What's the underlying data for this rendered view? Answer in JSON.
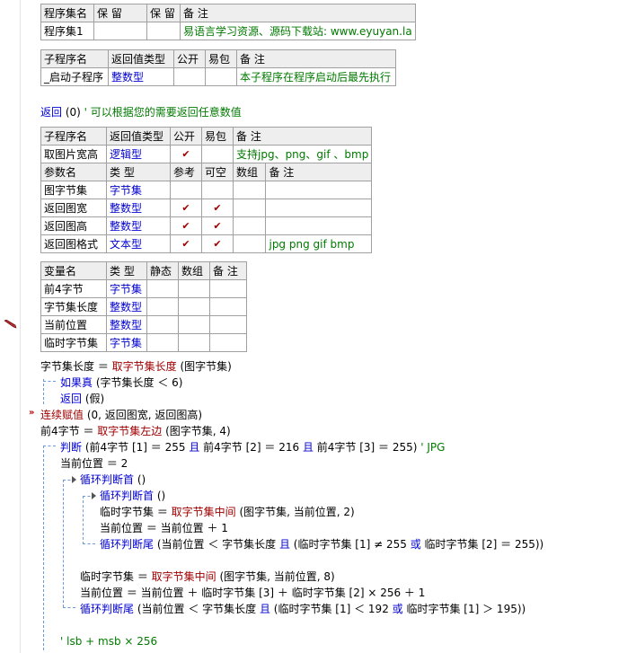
{
  "program_set": {
    "headers": [
      "程序集名",
      "保 留",
      "保 留",
      "备 注"
    ],
    "row": {
      "name": "程序集1",
      "r1": "",
      "r2": "",
      "note": "易语言学习资源、源码下载站: www.eyuyan.la"
    }
  },
  "sub_startup": {
    "headers": [
      "子程序名",
      "返回值类型",
      "公开",
      "易包",
      "备 注"
    ],
    "row": {
      "name": "_启动子程序",
      "type": "整数型",
      "public": "",
      "epkg": "",
      "note": "本子程序在程序启动后最先执行"
    }
  },
  "return_line": {
    "kw": "返回",
    "arg": " (0) ",
    "comment": "' 可以根据您的需要返回任意数值"
  },
  "sub_getsize": {
    "headers": [
      "子程序名",
      "返回值类型",
      "公开",
      "易包",
      "备 注"
    ],
    "row": {
      "name": "取图片宽高",
      "type": "逻辑型",
      "public": "✔",
      "epkg": "",
      "note": "支持jpg、png、gif 、bmp"
    },
    "param_headers": [
      "参数名",
      "类 型",
      "参考",
      "可空",
      "数组",
      "备 注"
    ],
    "params": [
      {
        "name": "图字节集",
        "type": "字节集",
        "ref": "",
        "opt": "",
        "arr": "",
        "note": ""
      },
      {
        "name": "返回图宽",
        "type": "整数型",
        "ref": "✔",
        "opt": "✔",
        "arr": "",
        "note": ""
      },
      {
        "name": "返回图高",
        "type": "整数型",
        "ref": "✔",
        "opt": "✔",
        "arr": "",
        "note": ""
      },
      {
        "name": "返回图格式",
        "type": "文本型",
        "ref": "✔",
        "opt": "✔",
        "arr": "",
        "note": "jpg png gif bmp"
      }
    ]
  },
  "locals": {
    "headers": [
      "变量名",
      "类 型",
      "静态",
      "数组",
      "备 注"
    ],
    "rows": [
      {
        "name": "前4字节",
        "type": "字节集"
      },
      {
        "name": "字节集长度",
        "type": "整数型"
      },
      {
        "name": "当前位置",
        "type": "整数型"
      },
      {
        "name": "临时字节集",
        "type": "字节集"
      }
    ]
  },
  "code": {
    "l1": {
      "a": "字节集长度 ＝ ",
      "f": "取字节集长度",
      "b": " (图字节集)"
    },
    "l2": {
      "k": "如果真",
      "b": " (字节集长度 ＜ 6)"
    },
    "l3": {
      "k": "返回",
      "b": " (假)"
    },
    "l4": {
      "f": "连续赋值",
      "b": " (0, 返回图宽, 返回图高)"
    },
    "l5": {
      "a": "前4字节 ＝ ",
      "f": "取字节集左边",
      "b": " (图字节集, 4)"
    },
    "l6": {
      "k": "判断",
      "b1": " (前4字节 [1] ＝ 255 ",
      "k2": "且",
      "b2": " 前4字节 [2] ＝ 216 ",
      "k3": "且",
      "b3": " 前4字节 [3] ＝ 255) ",
      "c": "' JPG"
    },
    "l7": {
      "a": "当前位置 ＝ 2"
    },
    "l8": {
      "k": "循环判断首",
      "b": " ()"
    },
    "l9": {
      "k": "循环判断首",
      "b": " ()"
    },
    "l10": {
      "a": "临时字节集 ＝ ",
      "f": "取字节集中间",
      "b": " (图字节集, 当前位置, 2)"
    },
    "l11": {
      "a": "当前位置 ＝ 当前位置 ＋ 1"
    },
    "l12": {
      "k": "循环判断尾",
      "b1": " (当前位置 ＜ 字节集长度 ",
      "k2": "且",
      "b2": " (临时字节集 [1] ≠ 255 ",
      "k3": "或",
      "b3": " 临时字节集 [2] ＝ 255))"
    },
    "l13": {
      "a": "临时字节集 ＝ ",
      "f": "取字节集中间",
      "b": " (图字节集, 当前位置, 8)"
    },
    "l14": {
      "a": "当前位置 ＝ 当前位置 ＋ 临时字节集 [3] ＋ 临时字节集 [2] × 256 ＋ 1"
    },
    "l15": {
      "k": "循环判断尾",
      "b1": " (当前位置 ＜ 字节集长度 ",
      "k2": "且",
      "b2": " (临时字节集 [1] ＜ 192 ",
      "k3": "或",
      "b3": " 临时字节集 [1] ＞ 195))"
    },
    "l16": {
      "c": "' lsb + msb × 256"
    }
  },
  "markers": {
    "pen_icon": "pencil-icon",
    "exec_arrow": "»"
  }
}
